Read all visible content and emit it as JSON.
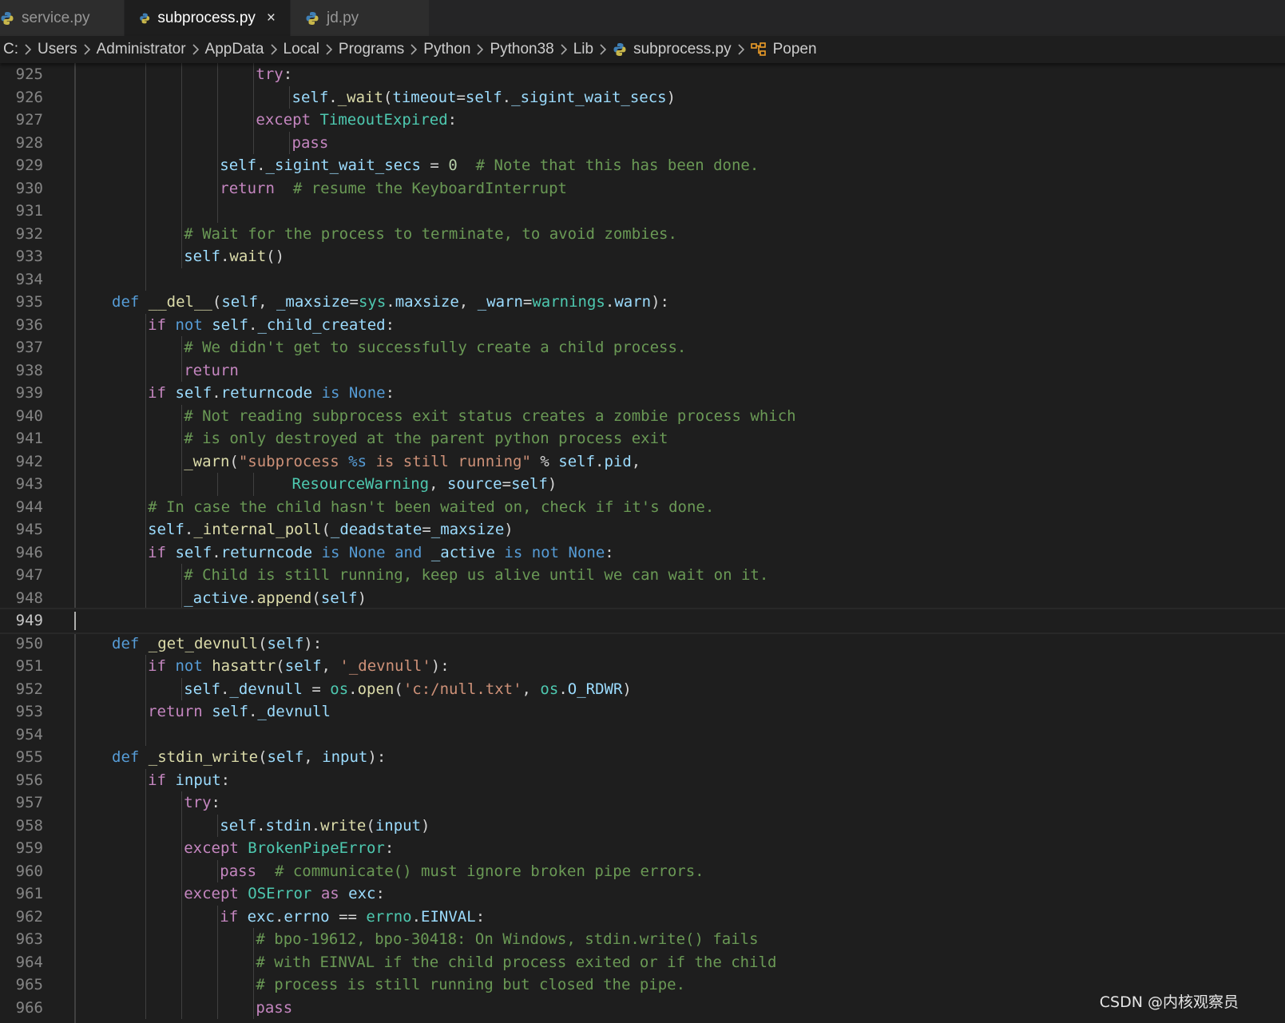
{
  "tabs": [
    {
      "label": "service.py",
      "active": false
    },
    {
      "label": "subprocess.py",
      "active": true,
      "close": "×"
    },
    {
      "label": "jd.py",
      "active": false
    }
  ],
  "breadcrumb": [
    "C:",
    "Users",
    "Administrator",
    "AppData",
    "Local",
    "Programs",
    "Python",
    "Python38",
    "Lib",
    "subprocess.py",
    "Popen"
  ],
  "colors": {
    "background": "#1e1e1e",
    "keyword": "#c586c0",
    "builtin": "#569cd6",
    "variable": "#9cdcfe",
    "function": "#dcdcaa",
    "type": "#4ec9b0",
    "string": "#ce9178",
    "comment": "#6a9955",
    "number": "#b5cea8"
  },
  "current_line": 949,
  "editor": {
    "lines": [
      {
        "n": "925",
        "i": 5,
        "t": [
          [
            "k",
            "try"
          ],
          [
            "p",
            ":"
          ]
        ]
      },
      {
        "n": "926",
        "i": 6,
        "t": [
          [
            "v",
            "self"
          ],
          [
            "p",
            "."
          ],
          [
            "f",
            "_wait"
          ],
          [
            "p",
            "("
          ],
          [
            "v",
            "timeout"
          ],
          [
            "p",
            "="
          ],
          [
            "v",
            "self"
          ],
          [
            "p",
            "."
          ],
          [
            "v",
            "_sigint_wait_secs"
          ],
          [
            "p",
            ")"
          ]
        ]
      },
      {
        "n": "927",
        "i": 5,
        "t": [
          [
            "k",
            "except"
          ],
          [
            "p",
            " "
          ],
          [
            "t",
            "TimeoutExpired"
          ],
          [
            "p",
            ":"
          ]
        ]
      },
      {
        "n": "928",
        "i": 6,
        "t": [
          [
            "k",
            "pass"
          ]
        ]
      },
      {
        "n": "929",
        "i": 4,
        "t": [
          [
            "v",
            "self"
          ],
          [
            "p",
            "."
          ],
          [
            "v",
            "_sigint_wait_secs"
          ],
          [
            "p",
            " = "
          ],
          [
            "n",
            "0"
          ],
          [
            "p",
            "  "
          ],
          [
            "c",
            "# Note that this has been done."
          ]
        ]
      },
      {
        "n": "930",
        "i": 4,
        "t": [
          [
            "k",
            "return"
          ],
          [
            "p",
            "  "
          ],
          [
            "c",
            "# resume the KeyboardInterrupt"
          ]
        ]
      },
      {
        "n": "931",
        "i": 0,
        "g": 3,
        "t": []
      },
      {
        "n": "932",
        "i": 3,
        "t": [
          [
            "c",
            "# Wait for the process to terminate, to avoid zombies."
          ]
        ]
      },
      {
        "n": "933",
        "i": 3,
        "t": [
          [
            "v",
            "self"
          ],
          [
            "p",
            "."
          ],
          [
            "f",
            "wait"
          ],
          [
            "p",
            "()"
          ]
        ]
      },
      {
        "n": "934",
        "i": 0,
        "g": 1,
        "t": []
      },
      {
        "n": "935",
        "i": 1,
        "t": [
          [
            "b",
            "def"
          ],
          [
            "p",
            " "
          ],
          [
            "f",
            "__del__"
          ],
          [
            "p",
            "("
          ],
          [
            "v",
            "self"
          ],
          [
            "p",
            ", "
          ],
          [
            "v",
            "_maxsize"
          ],
          [
            "p",
            "="
          ],
          [
            "t",
            "sys"
          ],
          [
            "p",
            "."
          ],
          [
            "v",
            "maxsize"
          ],
          [
            "p",
            ", "
          ],
          [
            "v",
            "_warn"
          ],
          [
            "p",
            "="
          ],
          [
            "t",
            "warnings"
          ],
          [
            "p",
            "."
          ],
          [
            "v",
            "warn"
          ],
          [
            "p",
            "):"
          ]
        ]
      },
      {
        "n": "936",
        "i": 2,
        "t": [
          [
            "k",
            "if"
          ],
          [
            "p",
            " "
          ],
          [
            "b",
            "not"
          ],
          [
            "p",
            " "
          ],
          [
            "v",
            "self"
          ],
          [
            "p",
            "."
          ],
          [
            "v",
            "_child_created"
          ],
          [
            "p",
            ":"
          ]
        ]
      },
      {
        "n": "937",
        "i": 3,
        "t": [
          [
            "c",
            "# We didn't get to successfully create a child process."
          ]
        ]
      },
      {
        "n": "938",
        "i": 3,
        "t": [
          [
            "k",
            "return"
          ]
        ]
      },
      {
        "n": "939",
        "i": 2,
        "t": [
          [
            "k",
            "if"
          ],
          [
            "p",
            " "
          ],
          [
            "v",
            "self"
          ],
          [
            "p",
            "."
          ],
          [
            "v",
            "returncode"
          ],
          [
            "p",
            " "
          ],
          [
            "b",
            "is"
          ],
          [
            "p",
            " "
          ],
          [
            "b",
            "None"
          ],
          [
            "p",
            ":"
          ]
        ]
      },
      {
        "n": "940",
        "i": 3,
        "t": [
          [
            "c",
            "# Not reading subprocess exit status creates a zombie process which"
          ]
        ]
      },
      {
        "n": "941",
        "i": 3,
        "t": [
          [
            "c",
            "# is only destroyed at the parent python process exit"
          ]
        ]
      },
      {
        "n": "942",
        "i": 3,
        "t": [
          [
            "f",
            "_warn"
          ],
          [
            "p",
            "("
          ],
          [
            "s",
            "\"subprocess "
          ],
          [
            "b",
            "%s"
          ],
          [
            "s",
            " is still running\""
          ],
          [
            "p",
            " % "
          ],
          [
            "v",
            "self"
          ],
          [
            "p",
            "."
          ],
          [
            "v",
            "pid"
          ],
          [
            "p",
            ","
          ]
        ]
      },
      {
        "n": "943",
        "i": 3,
        "x": 6,
        "g": 4,
        "t": [
          [
            "t",
            "ResourceWarning"
          ],
          [
            "p",
            ", "
          ],
          [
            "v",
            "source"
          ],
          [
            "p",
            "="
          ],
          [
            "v",
            "self"
          ],
          [
            "p",
            ")"
          ]
        ]
      },
      {
        "n": "944",
        "i": 2,
        "t": [
          [
            "c",
            "# In case the child hasn't been waited on, check if it's done."
          ]
        ]
      },
      {
        "n": "945",
        "i": 2,
        "t": [
          [
            "v",
            "self"
          ],
          [
            "p",
            "."
          ],
          [
            "f",
            "_internal_poll"
          ],
          [
            "p",
            "("
          ],
          [
            "v",
            "_deadstate"
          ],
          [
            "p",
            "="
          ],
          [
            "v",
            "_maxsize"
          ],
          [
            "p",
            ")"
          ]
        ]
      },
      {
        "n": "946",
        "i": 2,
        "t": [
          [
            "k",
            "if"
          ],
          [
            "p",
            " "
          ],
          [
            "v",
            "self"
          ],
          [
            "p",
            "."
          ],
          [
            "v",
            "returncode"
          ],
          [
            "p",
            " "
          ],
          [
            "b",
            "is"
          ],
          [
            "p",
            " "
          ],
          [
            "b",
            "None"
          ],
          [
            "p",
            " "
          ],
          [
            "b",
            "and"
          ],
          [
            "p",
            " "
          ],
          [
            "v",
            "_active"
          ],
          [
            "p",
            " "
          ],
          [
            "b",
            "is"
          ],
          [
            "p",
            " "
          ],
          [
            "b",
            "not"
          ],
          [
            "p",
            " "
          ],
          [
            "b",
            "None"
          ],
          [
            "p",
            ":"
          ]
        ]
      },
      {
        "n": "947",
        "i": 3,
        "t": [
          [
            "c",
            "# Child is still running, keep us alive until we can wait on it."
          ]
        ]
      },
      {
        "n": "948",
        "i": 3,
        "t": [
          [
            "v",
            "_active"
          ],
          [
            "p",
            "."
          ],
          [
            "f",
            "append"
          ],
          [
            "p",
            "("
          ],
          [
            "v",
            "self"
          ],
          [
            "p",
            ")"
          ]
        ]
      },
      {
        "n": "949",
        "i": 0,
        "g": 0,
        "t": []
      },
      {
        "n": "950",
        "i": 1,
        "t": [
          [
            "b",
            "def"
          ],
          [
            "p",
            " "
          ],
          [
            "f",
            "_get_devnull"
          ],
          [
            "p",
            "("
          ],
          [
            "v",
            "self"
          ],
          [
            "p",
            "):"
          ]
        ]
      },
      {
        "n": "951",
        "i": 2,
        "t": [
          [
            "k",
            "if"
          ],
          [
            "p",
            " "
          ],
          [
            "b",
            "not"
          ],
          [
            "p",
            " "
          ],
          [
            "f",
            "hasattr"
          ],
          [
            "p",
            "("
          ],
          [
            "v",
            "self"
          ],
          [
            "p",
            ", "
          ],
          [
            "s",
            "'_devnull'"
          ],
          [
            "p",
            "):"
          ]
        ]
      },
      {
        "n": "952",
        "i": 3,
        "t": [
          [
            "v",
            "self"
          ],
          [
            "p",
            "."
          ],
          [
            "v",
            "_devnull"
          ],
          [
            "p",
            " = "
          ],
          [
            "t",
            "os"
          ],
          [
            "p",
            "."
          ],
          [
            "f",
            "open"
          ],
          [
            "p",
            "("
          ],
          [
            "s",
            "'c:/null.txt'"
          ],
          [
            "p",
            ", "
          ],
          [
            "t",
            "os"
          ],
          [
            "p",
            "."
          ],
          [
            "v",
            "O_RDWR"
          ],
          [
            "p",
            ")"
          ]
        ]
      },
      {
        "n": "953",
        "i": 2,
        "t": [
          [
            "k",
            "return"
          ],
          [
            "p",
            " "
          ],
          [
            "v",
            "self"
          ],
          [
            "p",
            "."
          ],
          [
            "v",
            "_devnull"
          ]
        ]
      },
      {
        "n": "954",
        "i": 0,
        "g": 1,
        "t": []
      },
      {
        "n": "955",
        "i": 1,
        "t": [
          [
            "b",
            "def"
          ],
          [
            "p",
            " "
          ],
          [
            "f",
            "_stdin_write"
          ],
          [
            "p",
            "("
          ],
          [
            "v",
            "self"
          ],
          [
            "p",
            ", "
          ],
          [
            "v",
            "input"
          ],
          [
            "p",
            "):"
          ]
        ]
      },
      {
        "n": "956",
        "i": 2,
        "t": [
          [
            "k",
            "if"
          ],
          [
            "p",
            " "
          ],
          [
            "v",
            "input"
          ],
          [
            "p",
            ":"
          ]
        ]
      },
      {
        "n": "957",
        "i": 3,
        "t": [
          [
            "k",
            "try"
          ],
          [
            "p",
            ":"
          ]
        ]
      },
      {
        "n": "958",
        "i": 4,
        "t": [
          [
            "v",
            "self"
          ],
          [
            "p",
            "."
          ],
          [
            "v",
            "stdin"
          ],
          [
            "p",
            "."
          ],
          [
            "f",
            "write"
          ],
          [
            "p",
            "("
          ],
          [
            "v",
            "input"
          ],
          [
            "p",
            ")"
          ]
        ]
      },
      {
        "n": "959",
        "i": 3,
        "t": [
          [
            "k",
            "except"
          ],
          [
            "p",
            " "
          ],
          [
            "t",
            "BrokenPipeError"
          ],
          [
            "p",
            ":"
          ]
        ]
      },
      {
        "n": "960",
        "i": 4,
        "t": [
          [
            "k",
            "pass"
          ],
          [
            "p",
            "  "
          ],
          [
            "c",
            "# communicate() must ignore broken pipe errors."
          ]
        ]
      },
      {
        "n": "961",
        "i": 3,
        "t": [
          [
            "k",
            "except"
          ],
          [
            "p",
            " "
          ],
          [
            "t",
            "OSError"
          ],
          [
            "p",
            " "
          ],
          [
            "k",
            "as"
          ],
          [
            "p",
            " "
          ],
          [
            "v",
            "exc"
          ],
          [
            "p",
            ":"
          ]
        ]
      },
      {
        "n": "962",
        "i": 4,
        "t": [
          [
            "k",
            "if"
          ],
          [
            "p",
            " "
          ],
          [
            "v",
            "exc"
          ],
          [
            "p",
            "."
          ],
          [
            "v",
            "errno"
          ],
          [
            "p",
            " == "
          ],
          [
            "t",
            "errno"
          ],
          [
            "p",
            "."
          ],
          [
            "v",
            "EINVAL"
          ],
          [
            "p",
            ":"
          ]
        ]
      },
      {
        "n": "963",
        "i": 5,
        "t": [
          [
            "c",
            "# bpo-19612, bpo-30418: On Windows, stdin.write() fails"
          ]
        ]
      },
      {
        "n": "964",
        "i": 5,
        "t": [
          [
            "c",
            "# with EINVAL if the child process exited or if the child"
          ]
        ]
      },
      {
        "n": "965",
        "i": 5,
        "t": [
          [
            "c",
            "# process is still running but closed the pipe."
          ]
        ]
      },
      {
        "n": "966",
        "i": 5,
        "t": [
          [
            "k",
            "pass"
          ]
        ]
      }
    ]
  },
  "watermark": "CSDN @内核观察员"
}
